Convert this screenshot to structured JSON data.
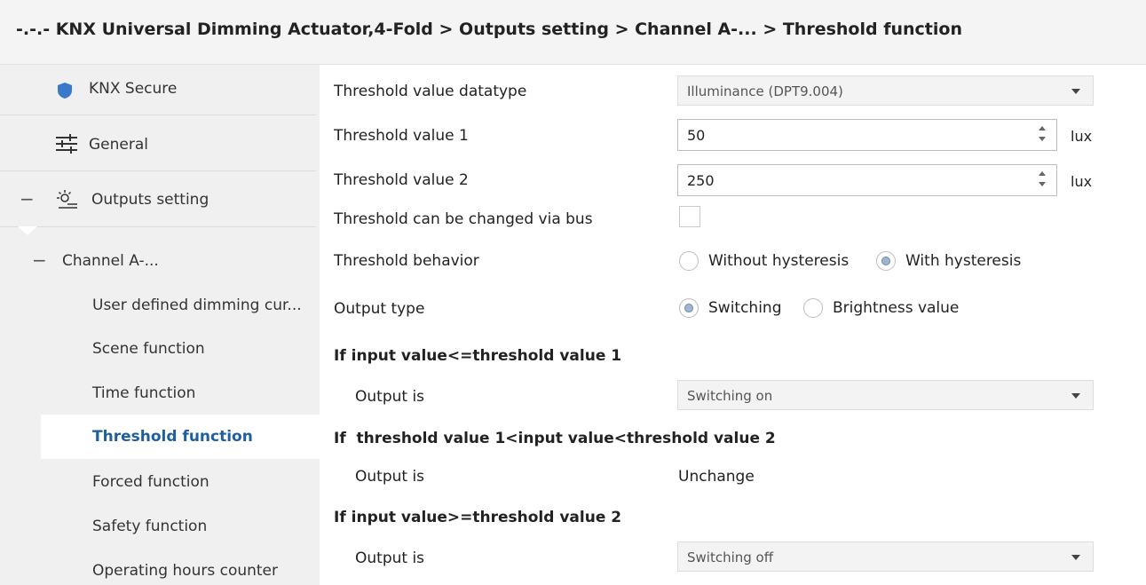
{
  "breadcrumb": "-.-.- KNX Universal Dimming Actuator,4-Fold > Outputs setting > Channel A-... > Threshold function",
  "sidebar": {
    "knx_secure": "KNX Secure",
    "general": "General",
    "outputs_setting": "Outputs setting",
    "channel": "Channel A-...",
    "items": [
      "User defined dimming cur...",
      "Scene function",
      "Time function",
      "Threshold function",
      "Forced function",
      "Safety function",
      "Operating hours counter"
    ],
    "collapse_symbol": "−"
  },
  "form": {
    "datatype_label": "Threshold value datatype",
    "datatype_value": "Illuminance (DPT9.004)",
    "threshold1_label": "Threshold value 1",
    "threshold1_value": "50",
    "threshold2_label": "Threshold value 2",
    "threshold2_value": "250",
    "unit": "lux",
    "bus_change_label": "Threshold can be changed via bus",
    "behavior_label": "Threshold behavior",
    "behavior_opt1": "Without hysteresis",
    "behavior_opt2": "With hysteresis",
    "output_type_label": "Output type",
    "output_type_opt1": "Switching",
    "output_type_opt2": "Brightness value",
    "section1": "If input value<=threshold value 1",
    "section2": "If  threshold value 1<input value<threshold value 2",
    "section3": "If input value>=threshold value 2",
    "output_is_label": "Output is",
    "output1_value": "Switching on",
    "output2_value": "Unchange",
    "output3_value": "Switching off"
  },
  "colors": {
    "accent": "#1f5f9e",
    "shield": "#3a78c9"
  }
}
